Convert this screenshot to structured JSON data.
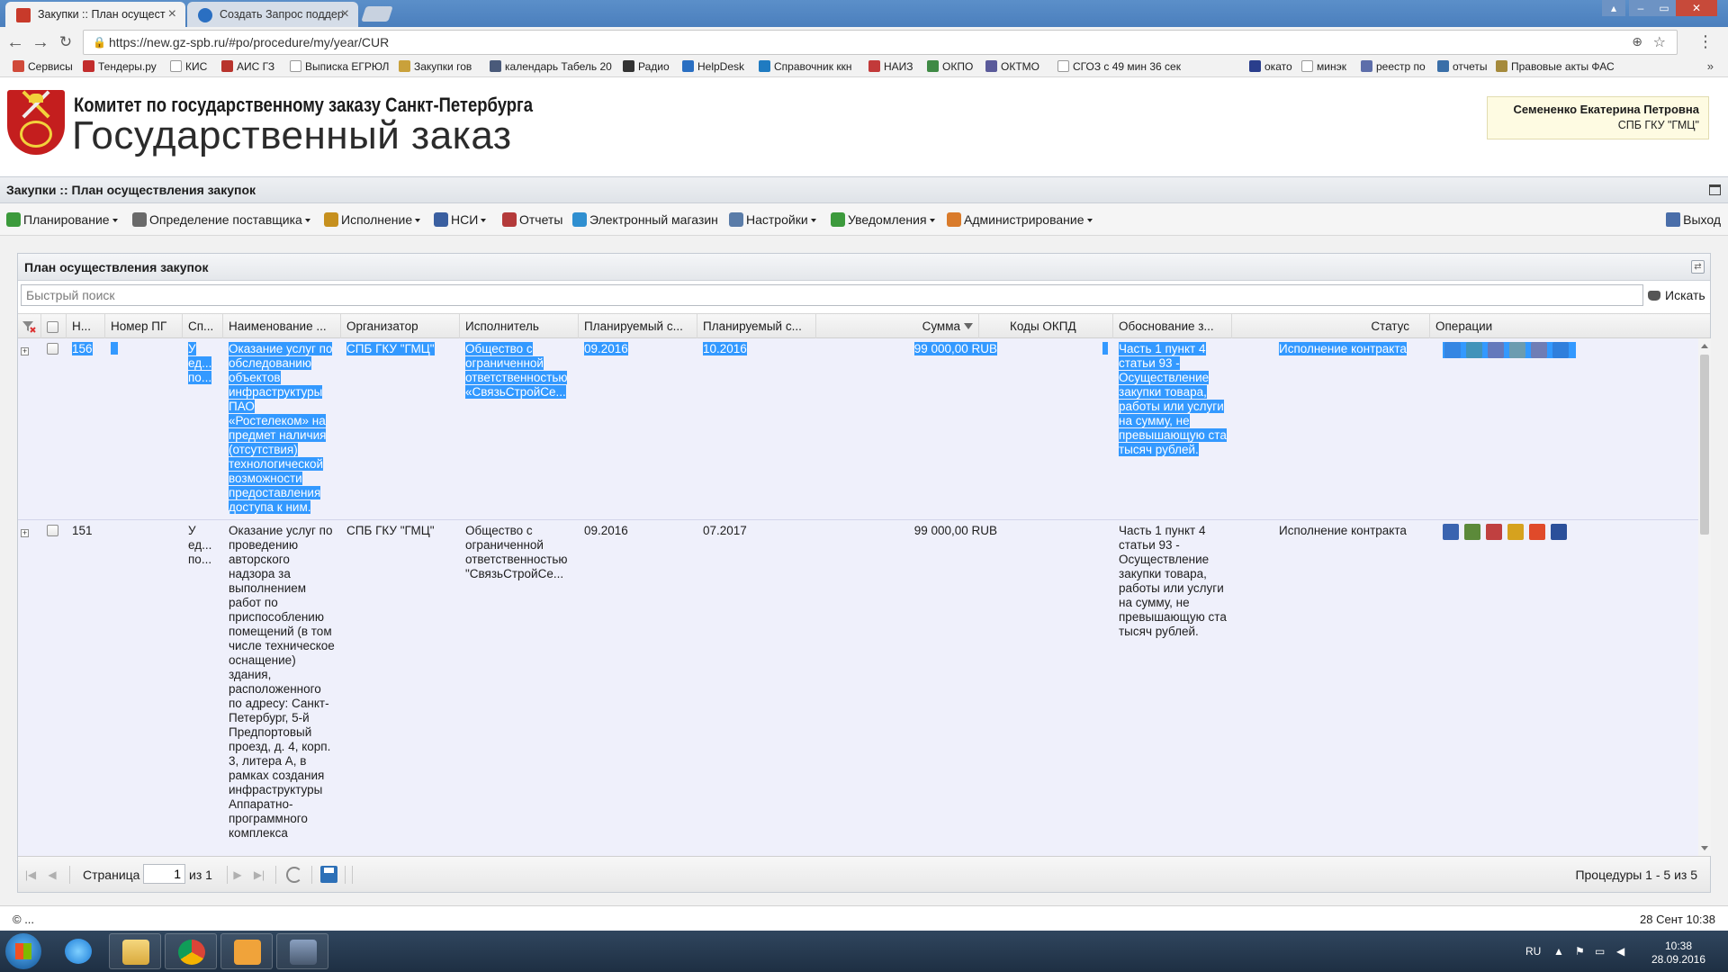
{
  "browser": {
    "tabs": [
      {
        "title": "Закупки :: План осущест",
        "active": true
      },
      {
        "title": "Создать Запрос поддер",
        "active": false
      }
    ],
    "url": "https://new.gz-spb.ru/#po/procedure/my/year/CUR",
    "bookmarks": [
      {
        "label": "Сервисы",
        "icon": "apps-icon",
        "color": "#d04a3a"
      },
      {
        "label": "Тендеры.ру",
        "icon": "tender-icon",
        "color": "#c22d2d"
      },
      {
        "label": "КИС",
        "icon": "page-icon",
        "color": "#ffffff"
      },
      {
        "label": "АИС ГЗ",
        "icon": "ais-icon",
        "color": "#b8342d"
      },
      {
        "label": "Выписка ЕГРЮЛ",
        "icon": "page-icon",
        "color": "#ffffff"
      },
      {
        "label": "Закупки гов",
        "icon": "emblem-icon",
        "color": "#c9a13b"
      },
      {
        "label": "календарь Табель 20",
        "icon": "calendar-icon",
        "color": "#4a5a7a"
      },
      {
        "label": "Радио",
        "icon": "play-icon",
        "color": "#333333"
      },
      {
        "label": "HelpDesk",
        "icon": "help-icon",
        "color": "#2a6fc2"
      },
      {
        "label": "Справочник ккн",
        "icon": "globe-icon",
        "color": "#1f7bc1"
      },
      {
        "label": "НАИЗ",
        "icon": "naiz-icon",
        "color": "#c23a3a"
      },
      {
        "label": "ОКПО",
        "icon": "okpo-icon",
        "color": "#3f8a45"
      },
      {
        "label": "ОКТМО",
        "icon": "oktmo-icon",
        "color": "#5a5a9a"
      },
      {
        "label": "СГОЗ с 49 мин 36 сек",
        "icon": "page-icon",
        "color": "#ffffff"
      },
      {
        "label": "окато",
        "icon": "star-icon",
        "color": "#2a3e8c"
      },
      {
        "label": "минэк",
        "icon": "page-icon",
        "color": "#ffffff"
      },
      {
        "label": "реестр по",
        "icon": "shield-icon",
        "color": "#5d6eaa"
      },
      {
        "label": "отчеты",
        "icon": "reports-icon",
        "color": "#3a6fa8"
      },
      {
        "label": "Правовые акты ФАС",
        "icon": "fas-icon",
        "color": "#a58a3c"
      }
    ]
  },
  "header": {
    "committee": "Комитет по государственному заказу Санкт-Петербурга",
    "title": "Государственный заказ",
    "user_name": "Семененко Екатерина Петровна",
    "user_org": "СПБ ГКУ \"ГМЦ\""
  },
  "app": {
    "title": "Закупки :: План осуществления закупок",
    "menu": [
      {
        "label": "Планирование",
        "icon": "planning-icon",
        "color": "#3c9a3c",
        "caret": true
      },
      {
        "label": "Определение поставщика",
        "icon": "gear-icon",
        "color": "#6a6a6a",
        "caret": true
      },
      {
        "label": "Исполнение",
        "icon": "execution-icon",
        "color": "#c6901e",
        "caret": true
      },
      {
        "label": "НСИ",
        "icon": "book-icon",
        "color": "#3a5fa0",
        "caret": true
      },
      {
        "label": "Отчеты",
        "icon": "report-icon",
        "color": "#b43a3a",
        "caret": false
      },
      {
        "label": "Электронный магазин",
        "icon": "cart-icon",
        "color": "#2f8fd0",
        "caret": false
      },
      {
        "label": "Настройки",
        "icon": "wrench-icon",
        "color": "#5a7ca8",
        "caret": true
      },
      {
        "label": "Уведомления",
        "icon": "notify-icon",
        "color": "#3c9a3c",
        "caret": true
      },
      {
        "label": "Администрирование",
        "icon": "admin-icon",
        "color": "#d97b2b",
        "caret": true
      }
    ],
    "logout": "Выход"
  },
  "panel": {
    "title": "План осуществления закупок",
    "search_placeholder": "Быстрый поиск",
    "search_button": "Искать",
    "columns": [
      "Н...",
      "Номер ПГ",
      "Сп...",
      "Наименование ...",
      "Организатор",
      "Исполнитель",
      "Планируемый с...",
      "Планируемый с...",
      "Сумма",
      "Коды ОКПД",
      "Обоснование з...",
      "Статус",
      "Операции"
    ],
    "rows": [
      {
        "num": "156",
        "pg": "",
        "method": "У ед... по...",
        "name": "Оказание услуг по обследованию объектов инфраструктуры ПАО «Ростелеком» на предмет наличия (отсутствия) технологической возможности предоставления доступа к ним.",
        "organizer": "СПБ ГКУ \"ГМЦ\"",
        "executor": "Общество с ограниченной ответственностью «СвязьСтройСе...",
        "start": "09.2016",
        "end": "10.2016",
        "sum": "99 000,00 RUB",
        "okpd": "",
        "reason": "Часть 1 пункт 4 статьи 93 - Осуществление закупки товара, работы или услуги на сумму, не превышающую ста тысяч рублей.",
        "status": "Исполнение контракта",
        "selected": true
      },
      {
        "num": "151",
        "pg": "",
        "method": "У ед... по...",
        "name": "Оказание услуг по проведению авторского надзора за выполнением работ по приспособлению помещений (в том числе техническое оснащение) здания, расположенного по адресу: Санкт-Петербург, 5-й Предпортовый проезд, д. 4, корп. 3, литера А, в рамках создания инфраструктуры Аппаратно-программного комплекса",
        "organizer": "СПБ ГКУ \"ГМЦ\"",
        "executor": "Общество с ограниченной ответственностью \"СвязьСтройСе...",
        "start": "09.2016",
        "end": "07.2017",
        "sum": "99 000,00 RUB",
        "okpd": "",
        "reason": "Часть 1 пункт 4 статьи 93 - Осуществление закупки товара, работы или услуги на сумму, не превышающую ста тысяч рублей.",
        "status": "Исполнение контракта",
        "selected": false
      }
    ],
    "operations": [
      {
        "icon": "chart-icon",
        "color": "#3a64b0"
      },
      {
        "icon": "settings-icon",
        "color": "#5c8a3a"
      },
      {
        "icon": "document-icon",
        "color": "#c04040"
      },
      {
        "icon": "edit-icon",
        "color": "#d6a21e"
      },
      {
        "icon": "delete-icon",
        "color": "#e04a2a"
      },
      {
        "icon": "barcode-icon",
        "color": "#2b4f9a"
      }
    ],
    "pager": {
      "page_label": "Страница",
      "page": "1",
      "of": "из 1",
      "summary": "Процедуры 1 - 5 из 5"
    }
  },
  "status": {
    "copyright": "© ...",
    "date": "28 Сент 10:38"
  },
  "taskbar": {
    "lang": "RU",
    "time": "10:38",
    "date": "28.09.2016"
  }
}
